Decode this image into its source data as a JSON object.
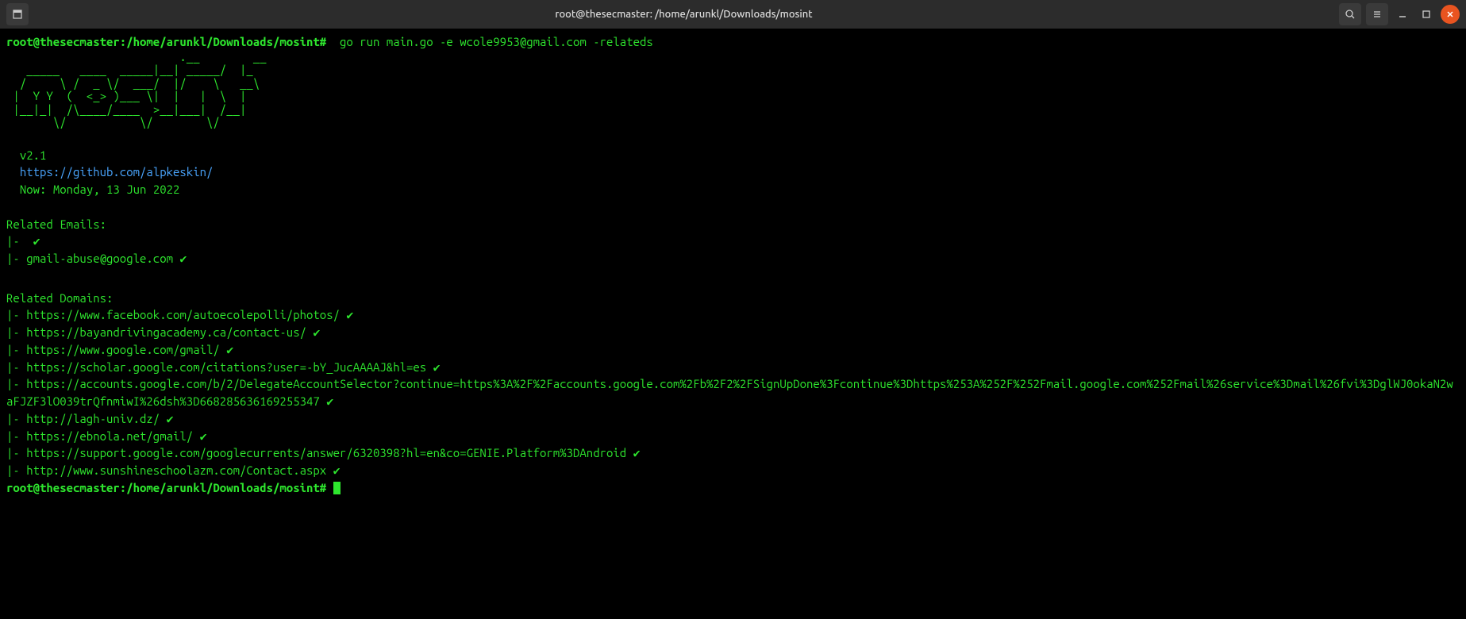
{
  "titlebar": {
    "title": "root@thesecmaster: /home/arunkl/Downloads/mosint"
  },
  "prompt1": "root@thesecmaster:/home/arunkl/Downloads/mosint#",
  "command": "  go run main.go -e wcole9953@gmail.com -relateds",
  "ascii": [
    "                          .__        __   ",
    "   _____   ____  _____|__| _____/  |_ ",
    "  /     \\ /  _ \\/  ___/  |/    \\   __\\",
    " |  Y Y  (  <_> )___ \\|  |   |  \\  |  ",
    " |__|_|  /\\____/____  >__|___|  /__|  ",
    "       \\/           \\/        \\/     "
  ],
  "version": "  v2.1",
  "github": "  https://github.com/alpkeskin/",
  "now": "  Now: Monday, 13 Jun 2022",
  "relatedEmailsHeader": "Related Emails:",
  "relatedEmails": [
    "",
    "gmail-abuse@google.com"
  ],
  "relatedDomainsHeader": "Related Domains:",
  "relatedDomains": [
    "https://www.facebook.com/autoecolepolli/photos/",
    "https://bayandrivingacademy.ca/contact-us/",
    "https://www.google.com/gmail/",
    "https://scholar.google.com/citations?user=-bY_JucAAAAJ&hl=es",
    "https://accounts.google.com/b/2/DelegateAccountSelector?continue=https%3A%2F%2Faccounts.google.com%2Fb%2F2%2FSignUpDone%3Fcontinue%3Dhttps%253A%252F%252Fmail.google.com%252Fmail%26service%3Dmail%26fvi%3DglWJ0okaN2waFJZF3lO039trQfnmiwI%26dsh%3D668285636169255347",
    "http://lagh-univ.dz/",
    "https://ebnola.net/gmail/",
    "https://support.google.com/googlecurrents/answer/6320398?hl=en&co=GENIE.Platform%3DAndroid",
    "http://www.sunshineschoolazm.com/Contact.aspx"
  ],
  "prompt2": "root@thesecmaster:/home/arunkl/Downloads/mosint#",
  "checkmark": "✔"
}
